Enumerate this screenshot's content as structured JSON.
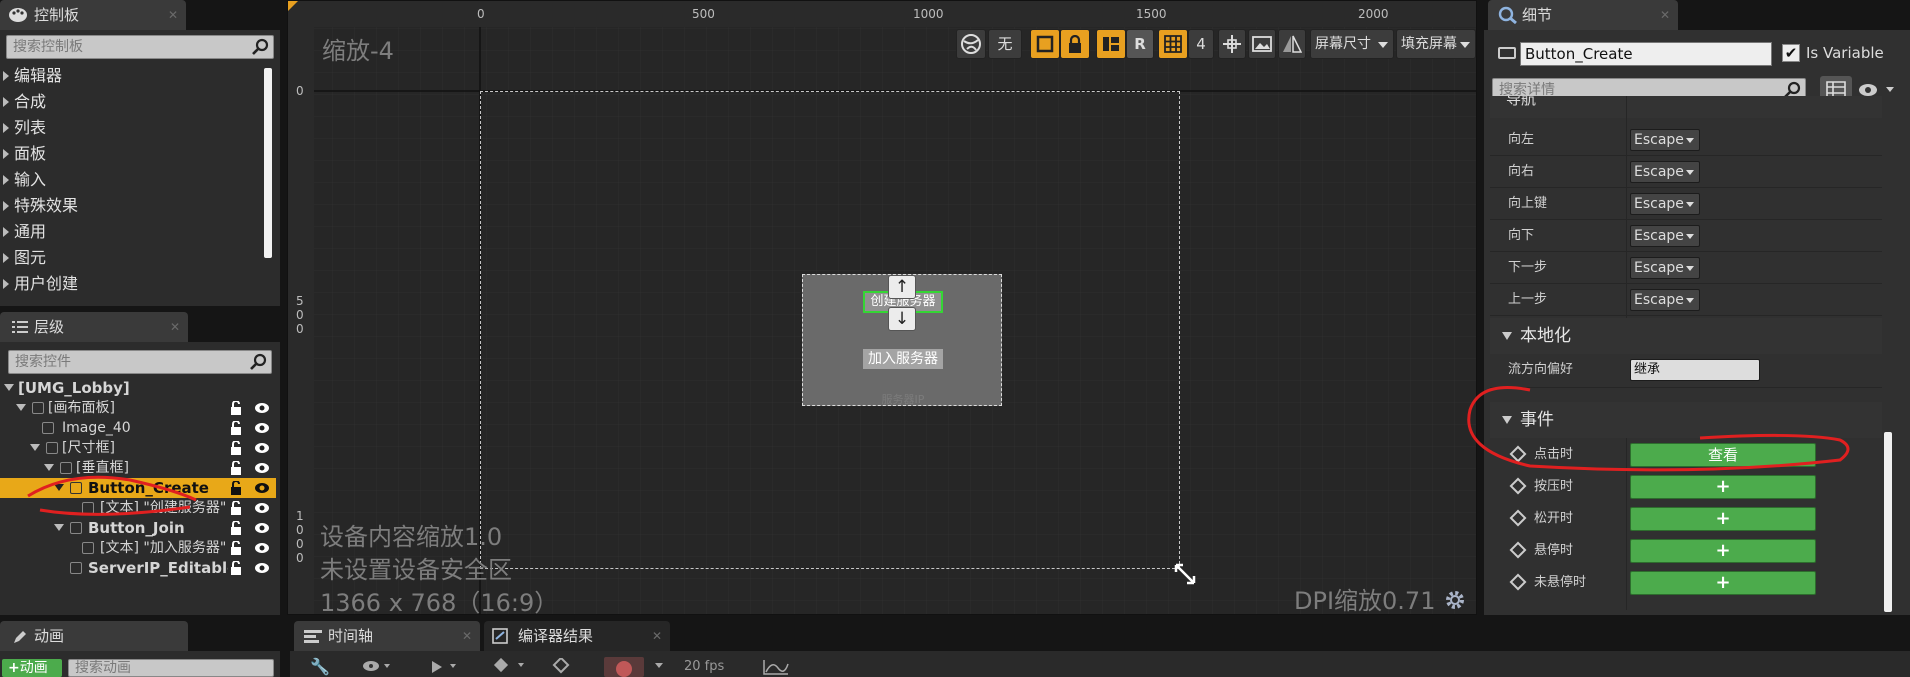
{
  "palette": {
    "panel": "#2c2c2c",
    "accent": "#e8a020",
    "green": "#4cab4c",
    "annotation": "#e02020"
  },
  "left_top": {
    "tab_label": "控制板",
    "search_placeholder": "搜索控制板",
    "categories": [
      "编辑器",
      "合成",
      "列表",
      "面板",
      "输入",
      "特殊效果",
      "通用",
      "图元",
      "用户创建"
    ]
  },
  "hierarchy": {
    "tab_label": "层级",
    "search_placeholder": "搜索控件",
    "items": [
      {
        "label": "[UMG_Lobby]"
      },
      {
        "label": "[画布面板]"
      },
      {
        "label": "Image_40"
      },
      {
        "label": "[尺寸框]"
      },
      {
        "label": "[垂直框]"
      },
      {
        "label": "Button_Create"
      },
      {
        "label": "[文本] \"创建服务器\""
      },
      {
        "label": "Button_Join"
      },
      {
        "label": "[文本] \"加入服务器\""
      },
      {
        "label": "ServerIP_Editable"
      }
    ]
  },
  "designer": {
    "zoom_label": "缩放-4",
    "ruler_top": [
      "0",
      "500",
      "1000",
      "1500",
      "2000"
    ],
    "ruler_left": [
      [
        "0"
      ],
      [
        "5",
        "0",
        "0"
      ],
      [
        "1",
        "0",
        "0",
        "0"
      ]
    ],
    "toolbar": {
      "none_label": "无",
      "r_label": "R",
      "grid_value": "4",
      "screen_size": "屏幕尺寸",
      "fill_screen": "填充屏幕"
    },
    "widget": {
      "create_button": "创建服务器",
      "join_button": "加入服务器",
      "ip_hint": "服务器IP"
    },
    "overlay": {
      "device_scale": "设备内容缩放1.0",
      "safe_zone": "未设置设备安全区",
      "resolution": "1366 x 768（16:9）",
      "dpi": "DPI缩放0.71"
    }
  },
  "details": {
    "tab_label": "细节",
    "name_value": "Button_Create",
    "is_variable_label": "Is Variable",
    "search_placeholder": "搜索详情",
    "nav_section": "导航",
    "nav_rows": [
      {
        "label": "向左",
        "value": "Escape"
      },
      {
        "label": "向右",
        "value": "Escape"
      },
      {
        "label": "向上键",
        "value": "Escape"
      },
      {
        "label": "向下",
        "value": "Escape"
      },
      {
        "label": "下一步",
        "value": "Escape"
      },
      {
        "label": "上一步",
        "value": "Escape"
      }
    ],
    "loc_section": "本地化",
    "flow_label": "流方向偏好",
    "flow_value": "继承",
    "events_section": "事件",
    "events": [
      {
        "label": "点击时",
        "button": "查看"
      },
      {
        "label": "按压时",
        "button": "+"
      },
      {
        "label": "松开时",
        "button": "+"
      },
      {
        "label": "悬停时",
        "button": "+"
      },
      {
        "label": "未悬停时",
        "button": "+"
      }
    ]
  },
  "bottom": {
    "anim_tab": "动画",
    "add_anim": "动画",
    "search_anim": "搜索动画",
    "timeline_tab": "时间轴",
    "compiler_tab": "编译器结果",
    "fps": "20 fps"
  }
}
